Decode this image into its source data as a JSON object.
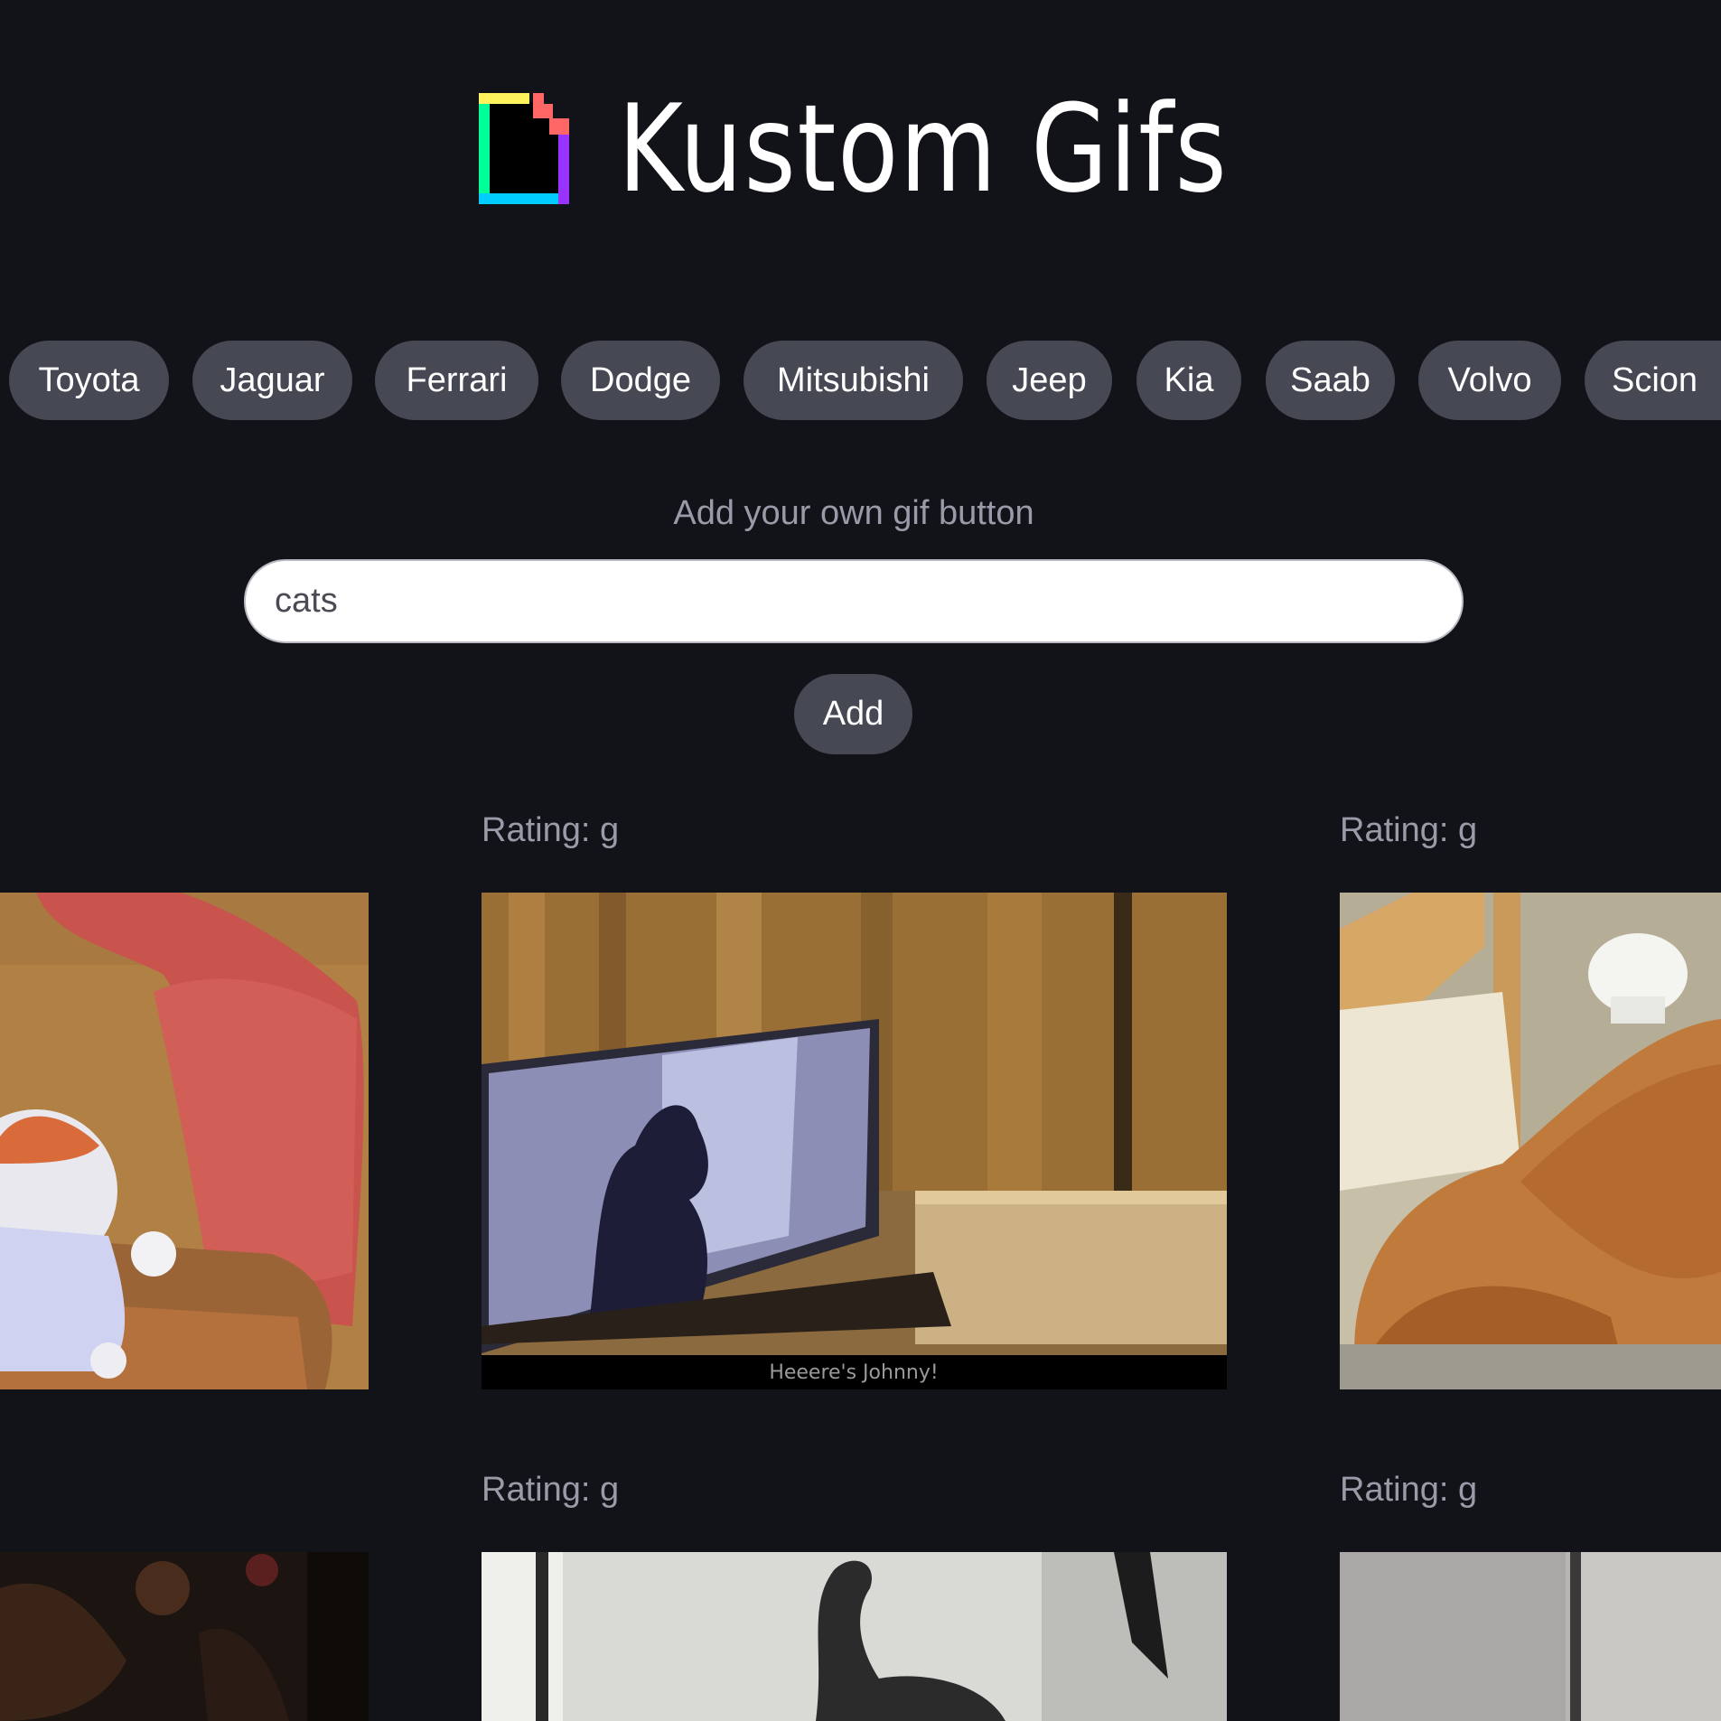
{
  "header": {
    "title": "Kustom Gifs",
    "logo_icon": "giphy-logo-icon"
  },
  "car_buttons": [
    {
      "label": "Toyota"
    },
    {
      "label": "Jaguar"
    },
    {
      "label": "Ferrari"
    },
    {
      "label": "Dodge"
    },
    {
      "label": "Mitsubishi"
    },
    {
      "label": "Jeep"
    },
    {
      "label": "Kia"
    },
    {
      "label": "Saab"
    },
    {
      "label": "Volvo"
    },
    {
      "label": "Scion"
    }
  ],
  "add_form": {
    "label": "Add your own gif button",
    "input_value": "cats",
    "button_label": "Add"
  },
  "gifs": [
    {
      "rating": "",
      "subject": "cat in clown costume on red chair"
    },
    {
      "rating": "Rating: g",
      "subject": "man on tv screen",
      "caption": "Heeere's Johnny!"
    },
    {
      "rating": "Rating: g",
      "subject": "orange cat wearing chef hat"
    },
    {
      "rating": "",
      "subject": "dark gif"
    },
    {
      "rating": "Rating: g",
      "subject": "black and white cat"
    },
    {
      "rating": "Rating: g",
      "subject": "grey room"
    }
  ],
  "colors": {
    "background": "#121318",
    "pill": "#464853",
    "muted_text": "#9a9ba8",
    "input_bg": "#ffffff"
  }
}
